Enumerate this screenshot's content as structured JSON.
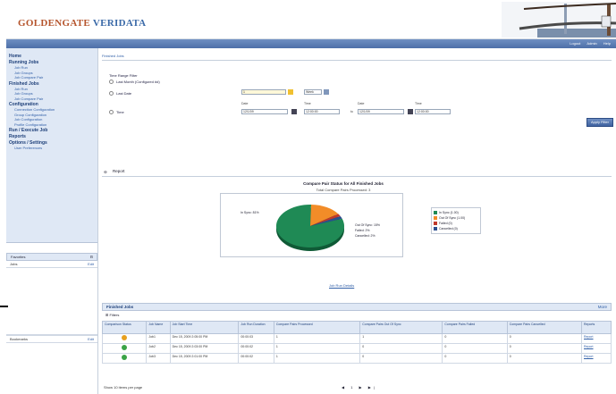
{
  "header": {
    "logo_part1": "GOLDENGATE",
    "logo_part2": "VERIDATA",
    "bridge_icon": "bridge-illustration"
  },
  "topbar": {
    "links": [
      "Logout",
      "Admin",
      "Help"
    ]
  },
  "sidebar": {
    "sections": [
      {
        "title": "Home",
        "items": []
      },
      {
        "title": "Running Jobs",
        "items": [
          "Job Run",
          "Job Groups",
          "Job Compare Pair"
        ]
      },
      {
        "title": "Finished Jobs",
        "items": [
          "Job Run",
          "Job Groups",
          "Job Compare Pair"
        ]
      },
      {
        "title": "Configuration",
        "items": [
          "Connection Configuration",
          "Group Configuration",
          "Job Configuration",
          "Profile Configuration"
        ]
      },
      {
        "title": "Run / Execute Job",
        "items": []
      },
      {
        "title": "Reports",
        "items": []
      },
      {
        "title": "Options / Settings",
        "items": [
          "User Preferences"
        ]
      }
    ],
    "panel1": {
      "title": "Favorites",
      "col": "Jobs",
      "col2": "Edit"
    },
    "panel2": {
      "title": "Bookmarks",
      "col2": "Edit"
    }
  },
  "main": {
    "breadcrumb": "Finished Jobs",
    "filter": {
      "label": "Time Range Filter",
      "opt1": "Last Month (Configured #d)",
      "opt2": "Last Date",
      "opt3": "Time",
      "field1": "1",
      "field1_unit": "Week",
      "date_label": "Date",
      "time_label": "Time",
      "d1": "12/1/09",
      "t1": "12:00:00",
      "to_label": "to",
      "d2": "12/1/09",
      "t2": "12:00:00",
      "go": "Apply Filter"
    },
    "report_header": "Report",
    "chart_link": "Job Run Details"
  },
  "chart_data": {
    "type": "pie",
    "title": "Compare Pair Status for All Finished Jobs",
    "subtitle": "Total Compare Pairs Processed: 3",
    "slices": [
      {
        "name": "In Sync",
        "value": 81,
        "color": "#1f8a55"
      },
      {
        "name": "Out Of Sync",
        "value": 15,
        "color": "#f28c28"
      },
      {
        "name": "Failed",
        "value": 2,
        "color": "#c0392b"
      },
      {
        "name": "Cancelled",
        "value": 2,
        "color": "#2c4f8f"
      }
    ],
    "labels": [
      "In Sync: 81%",
      "Out Of Sync: 15%",
      "Failed: 2%",
      "Cancelled: 2%"
    ],
    "legend": [
      "In Sync (1.00)",
      "Out Of Sync (1.00)",
      "Failed (0)",
      "Cancelled (0)"
    ]
  },
  "dataset": {
    "title": "Finished Jobs",
    "more": "More",
    "filter_label": "Filters",
    "columns": [
      "Comparison Status",
      "Job Name",
      "Job Start Time",
      "Job Run Duration",
      "Compare Pairs Processed",
      "Compare Pairs Out Of Sync",
      "Compare Pairs Failed",
      "Compare Pairs Cancelled",
      "Reports"
    ],
    "rows": [
      {
        "status": "warn",
        "name": "Job1",
        "start": "Dec 15, 2009 2:05:00 PM",
        "duration": "00:00:03",
        "processed": "1",
        "out": "1",
        "failed": "0",
        "cancelled": "0",
        "report": "Report"
      },
      {
        "status": "ok",
        "name": "Job2",
        "start": "Dec 15, 2009 2:03:00 PM",
        "duration": "00:00:02",
        "processed": "1",
        "out": "0",
        "failed": "0",
        "cancelled": "0",
        "report": "Report"
      },
      {
        "status": "ok",
        "name": "Job3",
        "start": "Dec 15, 2009 2:01:00 PM",
        "duration": "00:00:02",
        "processed": "1",
        "out": "0",
        "failed": "0",
        "cancelled": "0",
        "report": "Report"
      }
    ],
    "pager_text": "Show 10 items per page",
    "pager_nums": "◀ 1 ▶ ▶|"
  },
  "colors": {
    "accent": "#4d6fa8",
    "ok": "#3aa346",
    "warn": "#e7a01f"
  }
}
